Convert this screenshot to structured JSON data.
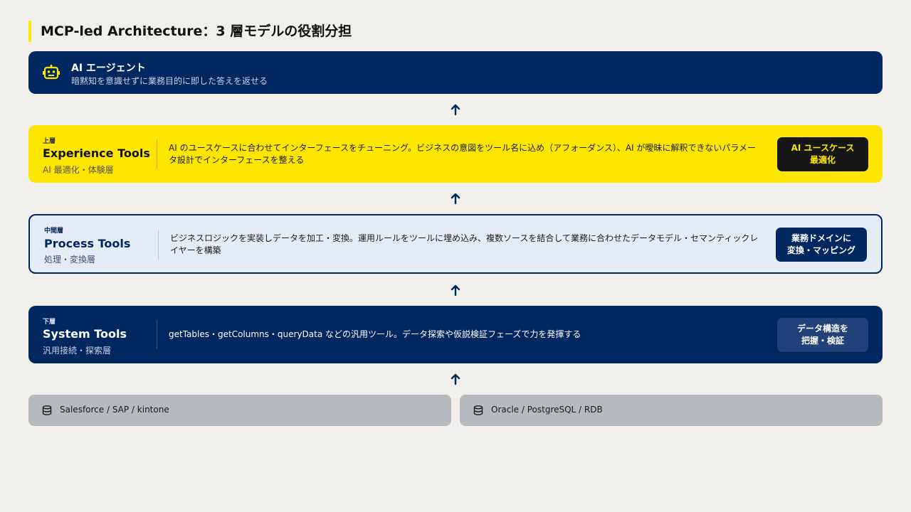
{
  "title": "MCP-led Architecture：3 層モデルの役割分担",
  "agent": {
    "icon": "robot-icon",
    "name": "AI エージェント",
    "description": "暗黙知を意識せずに業務目的に即した答えを返せる"
  },
  "layers": {
    "experience": {
      "tag": "上層",
      "name": "Experience Tools",
      "subtitle": "AI 最適化・体験層",
      "description": "AI のユースケースに合わせてインターフェースをチューニング。ビジネスの意図をツール名に込め（アフォーダンス）、AI が曖昧に解釈できないパラメータ設計でインターフェースを整える",
      "badge": "AI ユースケース\n最適化"
    },
    "process": {
      "tag": "中間層",
      "name": "Process Tools",
      "subtitle": "処理・変換層",
      "description": "ビジネスロジックを実装しデータを加工・変換。運用ルールをツールに埋め込み、複数ソースを結合して業務に合わせたデータモデル・セマンティックレイヤーを構築",
      "badge": "業務ドメインに\n変換・マッピング"
    },
    "system": {
      "tag": "下層",
      "name": "System Tools",
      "subtitle": "汎用接続・探索層",
      "description": "getTables・getColumns・queryData などの汎用ツール。データ探索や仮説検証フェーズで力を発揮する",
      "badge": "データ構造を\n把握・検証"
    }
  },
  "sources": [
    {
      "icon": "database-icon",
      "label": "Salesforce / SAP / kintone"
    },
    {
      "icon": "database-icon",
      "label": "Oracle / PostgreSQL / RDB"
    }
  ],
  "colors": {
    "navy": "#002760",
    "yellow": "#ffe600",
    "background": "#f1efeb",
    "source_gray": "#b6b9bd"
  }
}
